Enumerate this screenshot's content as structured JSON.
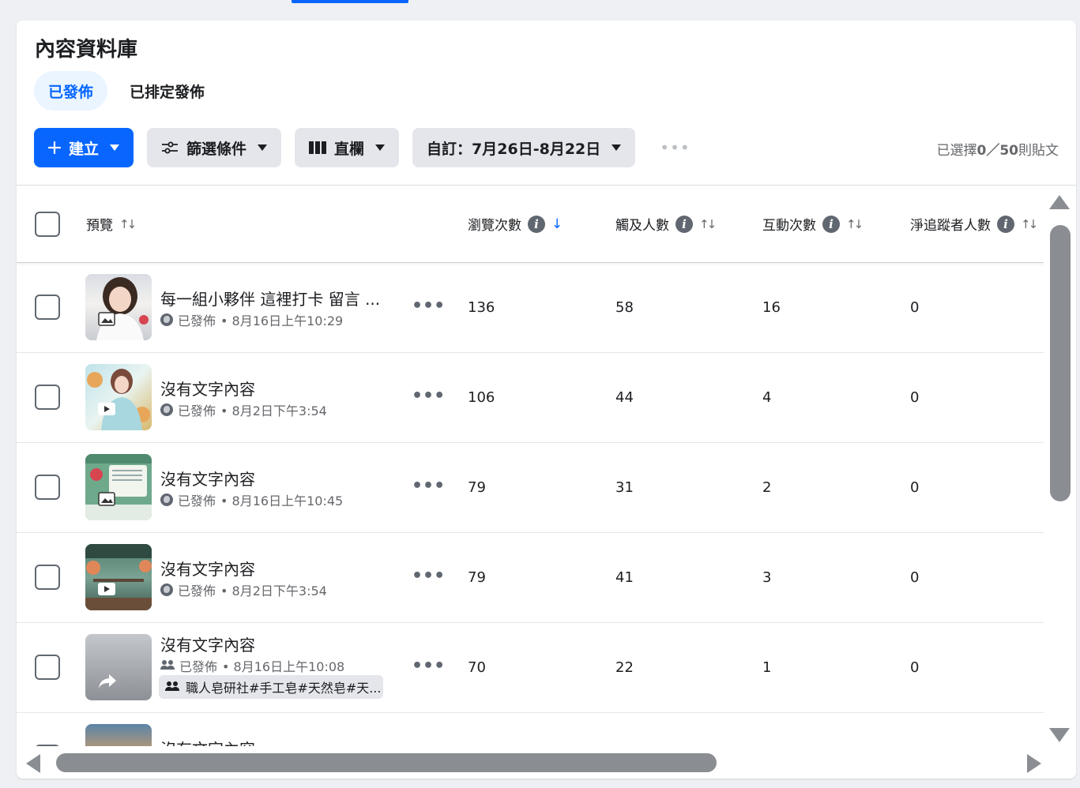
{
  "page": {
    "title": "內容資料庫"
  },
  "tabs": [
    {
      "label": "已發佈",
      "active": true
    },
    {
      "label": "已排定發佈",
      "active": false
    }
  ],
  "toolbar": {
    "create_label": "建立",
    "filter_label": "篩選條件",
    "columns_label": "直欄",
    "date_range_label": "自訂：7月26日-8月22日",
    "more_label": "•••"
  },
  "selection": {
    "prefix": "已選擇",
    "count": "0／50",
    "suffix": "則貼文"
  },
  "table": {
    "headers": {
      "preview": "預覽",
      "views": "瀏覽次數",
      "reach": "觸及人數",
      "engagement": "互動次數",
      "net_followers": "淨追蹤者人數"
    },
    "rows": [
      {
        "title": "每一組小夥伴 這裡打卡 留言 ...",
        "status": "已發佈",
        "date": "• 8月16日上午10:29",
        "views": "136",
        "reach": "58",
        "engagement": "16",
        "net_followers": "0",
        "audience": "public",
        "media": "photo"
      },
      {
        "title": "沒有文字內容",
        "status": "已發佈",
        "date": "• 8月2日下午3:54",
        "views": "106",
        "reach": "44",
        "engagement": "4",
        "net_followers": "0",
        "audience": "public",
        "media": "video"
      },
      {
        "title": "沒有文字內容",
        "status": "已發佈",
        "date": "• 8月16日上午10:45",
        "views": "79",
        "reach": "31",
        "engagement": "2",
        "net_followers": "0",
        "audience": "public",
        "media": "photo"
      },
      {
        "title": "沒有文字內容",
        "status": "已發佈",
        "date": "• 8月2日下午3:54",
        "views": "79",
        "reach": "41",
        "engagement": "3",
        "net_followers": "0",
        "audience": "public",
        "media": "video"
      },
      {
        "title": "沒有文字內容",
        "status": "已發佈",
        "date": "• 8月16日上午10:08",
        "views": "70",
        "reach": "22",
        "engagement": "1",
        "net_followers": "0",
        "audience": "group",
        "media": "share",
        "group_tag": "職人皂研社#手工皂#天然皂#天..."
      },
      {
        "title": "沒有文字內容"
      }
    ]
  },
  "colors": {
    "accent": "#0866ff",
    "accent_light": "#ebf5ff",
    "button_gray": "#e4e6eb",
    "secondary_text": "#65676b"
  }
}
